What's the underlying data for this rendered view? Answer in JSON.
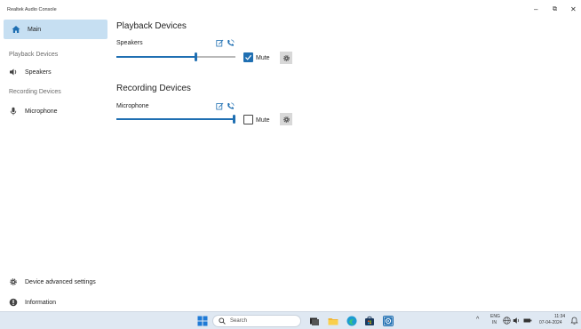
{
  "window": {
    "title": "Realtek Audio Console",
    "controls": {
      "minimize": "–",
      "maximize": "⧉",
      "close": "✕"
    }
  },
  "sidebar": {
    "main_label": "Main",
    "playback_section": "Playback Devices",
    "playback_items": [
      {
        "label": "Speakers",
        "icon": "speaker-icon"
      }
    ],
    "recording_section": "Recording Devices",
    "recording_items": [
      {
        "label": "Microphone",
        "icon": "microphone-icon"
      }
    ],
    "bottom_items": [
      {
        "label": "Device advanced settings",
        "icon": "gear-icon"
      },
      {
        "label": "Information",
        "icon": "info-icon"
      }
    ]
  },
  "main": {
    "playback": {
      "heading": "Playback Devices",
      "device_name": "Speakers",
      "volume_fraction": 0.67,
      "mute_label": "Mute",
      "muted": true
    },
    "recording": {
      "heading": "Recording Devices",
      "device_name": "Microphone",
      "volume_fraction": 1.0,
      "mute_label": "Mute",
      "muted": false
    }
  },
  "taskbar": {
    "search_placeholder": "Search",
    "apps": [
      "windows-start-icon",
      "task-view-icon",
      "file-explorer-icon",
      "edge-browser-icon",
      "store-icon",
      "realtek-audio-icon"
    ],
    "tray": {
      "chevron": "^",
      "language_top": "ENG",
      "language_bottom": "IN",
      "time": "11:34",
      "date": "07-04-2024"
    }
  },
  "colors": {
    "accent": "#1f6fb2",
    "selected_bg": "#c6dff2",
    "taskbar_bg": "#dfe8f2"
  }
}
